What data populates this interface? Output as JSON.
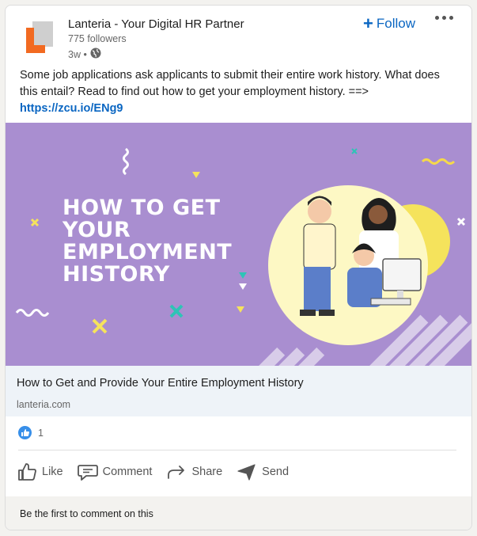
{
  "post": {
    "company_name": "Lanteria - Your Digital HR Partner",
    "followers": "775 followers",
    "time": "3w •",
    "follow_label": "Follow",
    "text": "Some job applications ask applicants to submit their entire work history. What does this entail? Read to find out how to get your employment history. ==>",
    "link": "https://zcu.io/ENg9"
  },
  "banner": {
    "headline_lines": [
      "HOW TO GET",
      "YOUR",
      "EMPLOYMENT",
      "HISTORY"
    ],
    "colors": {
      "background": "#a98ed0",
      "circle": "#fdf8c4",
      "sun": "#f5e35c"
    }
  },
  "link_preview": {
    "title": "How to Get and Provide Your Entire Employment History",
    "domain": "lanteria.com"
  },
  "social": {
    "reaction_count": "1",
    "actions": [
      "Like",
      "Comment",
      "Share",
      "Send"
    ],
    "comments_prompt": "Be the first to comment on this"
  },
  "colors": {
    "accent": "#0a66c2",
    "brand_orange": "#f26a21"
  }
}
